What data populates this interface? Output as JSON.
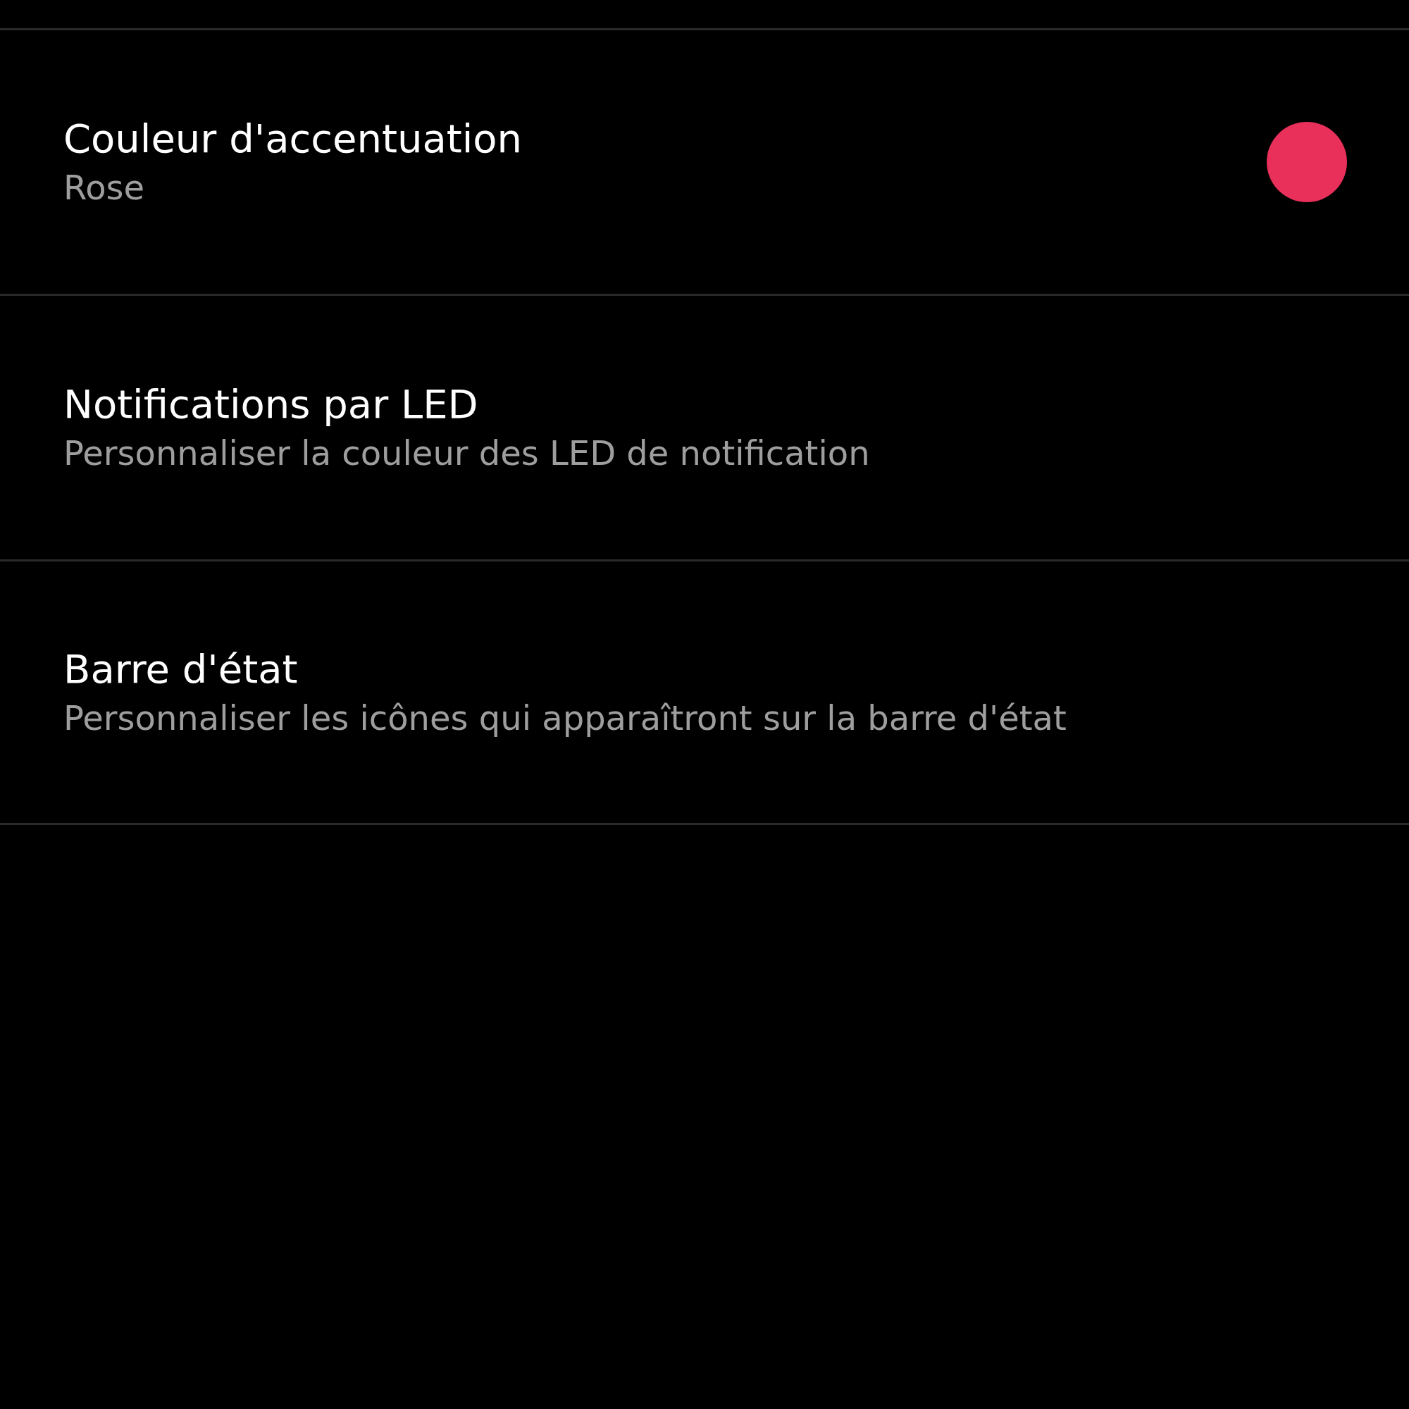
{
  "settings": [
    {
      "title": "Couleur d'accentuation",
      "summary": "Rose",
      "color": "#e8305a"
    },
    {
      "title": "Notifications par LED",
      "summary": "Personnaliser la couleur des LED de notification"
    },
    {
      "title": "Barre d'état",
      "summary": "Personnaliser les icônes qui apparaîtront sur la barre d'état"
    }
  ]
}
